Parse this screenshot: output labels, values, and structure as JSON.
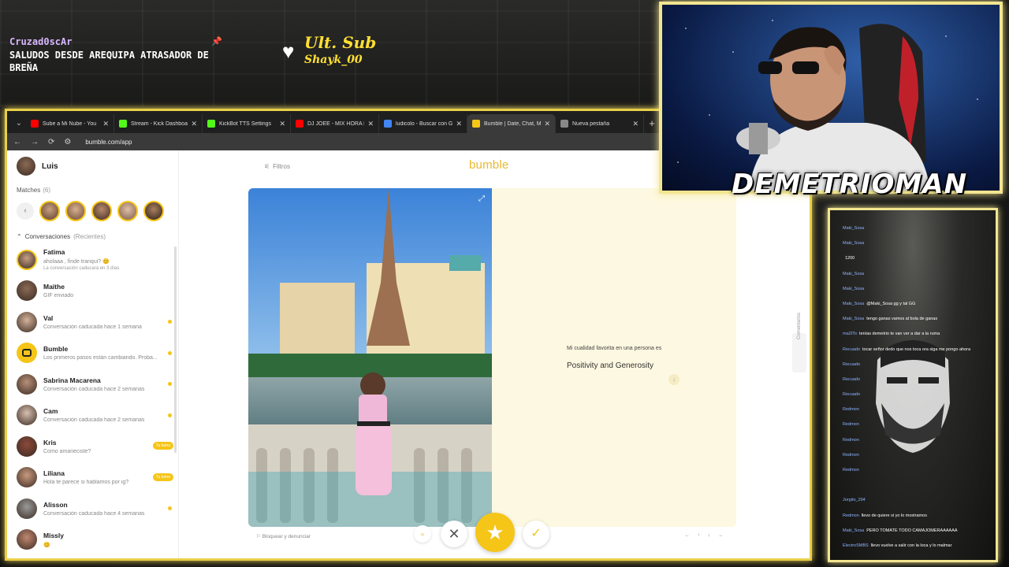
{
  "overlay": {
    "chat_user": "Cruzad0scAr",
    "chat_message": "SALUDOS DESDE AREQUIPA ATRASADOR DE BREÑA",
    "last_sub_label": "Ult. Sub",
    "last_sub_name": "Shayk_00",
    "streamer_name": "DEMETRIOMAN"
  },
  "browser": {
    "tabs": [
      {
        "label": "Sube a Mi Nube - You",
        "color": "#ff0000"
      },
      {
        "label": "Stream - Kick Dashboard",
        "color": "#53fc18"
      },
      {
        "label": "KickBot TTS Settings",
        "color": "#53fc18"
      },
      {
        "label": "DJ JOEE - MIX HORA LOC",
        "color": "#ff0000"
      },
      {
        "label": "ludicolo - Buscar con Goo",
        "color": "#4285f4"
      },
      {
        "label": "Bumble | Date, Chat, Meet",
        "color": "#f5c518"
      },
      {
        "label": "Nueva pestaña",
        "color": "#888888"
      }
    ],
    "url": "bumble.com/app"
  },
  "sidebar": {
    "user_name": "Luis",
    "matches_label": "Matches",
    "matches_count": "(6)",
    "conversations_label": "Conversaciones",
    "conversations_sort": "(Recientes)",
    "conversations": [
      {
        "name": "Fatima",
        "preview": "aholaaa , finde tranqui? 😊",
        "sub": "La conversación caducará en 3 días",
        "ring": true
      },
      {
        "name": "Maithe",
        "preview": "GIF enviado"
      },
      {
        "name": "Val",
        "preview": "Conversación caducada hace 1 semana",
        "dot": true
      },
      {
        "name": "Bumble",
        "preview": "Los primeros pasos están cambiando. Proba...",
        "dot": true,
        "bumble": true
      },
      {
        "name": "Sabrina Macarena",
        "preview": "Conversación caducada hace 2 semanas",
        "dot": true
      },
      {
        "name": "Cam",
        "preview": "Conversación caducada hace 2 semanas",
        "dot": true
      },
      {
        "name": "Kris",
        "preview": "Como amaneciste?",
        "badge": "Tu turno"
      },
      {
        "name": "Liliana",
        "preview": "Hola te parece si hablamos por ig?",
        "badge": "Tu turno"
      },
      {
        "name": "Alisson",
        "preview": "Conversación caducada hace 4 semanas",
        "dot": true
      },
      {
        "name": "Missly",
        "preview": "😊"
      }
    ]
  },
  "main": {
    "filter_label": "Filtros",
    "logo": "bumble",
    "prompt_question": "Mi cualidad favorita en una persona es",
    "prompt_answer": "Positivity and Generosity",
    "report_label": "Bloquear y denunciar",
    "side_tag": "Comentarios"
  },
  "chat_panel": {
    "lines": [
      {
        "user": "Maki_Sosa",
        "text": ""
      },
      {
        "user": "Maki_Sosa",
        "text": ""
      },
      {
        "user": "",
        "text": "1200"
      },
      {
        "user": "Maki_Sosa",
        "text": ""
      },
      {
        "user": "Maki_Sosa",
        "text": ""
      },
      {
        "user": "Maki_Sosa",
        "text": "@Maki_Sosa gg y tal GG"
      },
      {
        "user": "Maki_Sosa",
        "text": "tengo ganas vamos al bola de ganas"
      },
      {
        "user": "ma2ITo",
        "text": "tenías demetrio te van ver a dar a la ruma"
      },
      {
        "user": "Recuado",
        "text": "tocar señor dedo que nos toca ora siga me pongo ahora"
      },
      {
        "user": "Recuado",
        "text": ""
      },
      {
        "user": "Recuado",
        "text": ""
      },
      {
        "user": "Recuado",
        "text": ""
      },
      {
        "user": "Redmon",
        "text": ""
      },
      {
        "user": "Redmon",
        "text": ""
      },
      {
        "user": "Redmon",
        "text": ""
      },
      {
        "user": "Redmon",
        "text": ""
      },
      {
        "user": "Redmon",
        "text": ""
      },
      {
        "user": "",
        "text": ""
      },
      {
        "user": "Jorgito_294",
        "text": ""
      },
      {
        "user": "Redmon",
        "text": "llevo de quiere si yo lo mostramos"
      },
      {
        "user": "Maki_Sosa",
        "text": "PERO TOMATE TODO CAMAJOMERAAAAAA"
      },
      {
        "user": "ElectroSMBS",
        "text": "llevo vuelve a salir con la loca y lo malmar"
      }
    ]
  }
}
